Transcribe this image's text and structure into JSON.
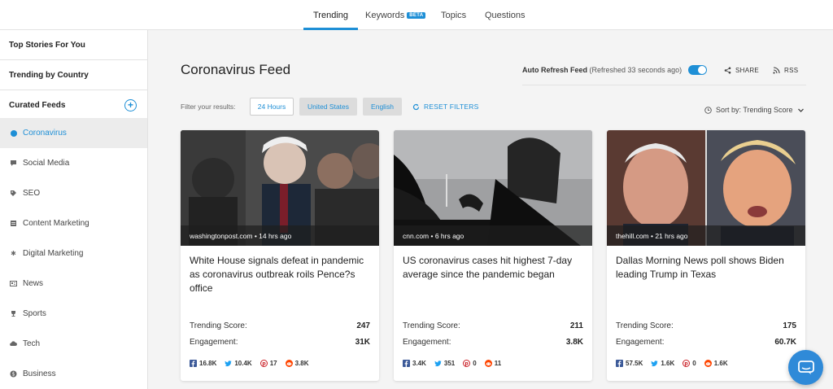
{
  "nav": {
    "tabs": [
      {
        "label": "Trending",
        "active": true
      },
      {
        "label": "Keywords",
        "badge": "BETA"
      },
      {
        "label": "Topics"
      },
      {
        "label": "Questions"
      }
    ]
  },
  "sidebar": {
    "top_stories": "Top Stories For You",
    "trending_by_country": "Trending by Country",
    "curated_feeds": "Curated Feeds",
    "feeds": [
      {
        "label": "Coronavirus",
        "icon": "dot-icon",
        "active": true
      },
      {
        "label": "Social Media",
        "icon": "chat-bubble-icon"
      },
      {
        "label": "SEO",
        "icon": "tag-icon"
      },
      {
        "label": "Content Marketing",
        "icon": "document-icon"
      },
      {
        "label": "Digital Marketing",
        "icon": "gear-icon"
      },
      {
        "label": "News",
        "icon": "newspaper-icon"
      },
      {
        "label": "Sports",
        "icon": "trophy-icon"
      },
      {
        "label": "Tech",
        "icon": "cloud-icon"
      },
      {
        "label": "Business",
        "icon": "dollar-icon"
      }
    ]
  },
  "main": {
    "title": "Coronavirus Feed",
    "auto_refresh_label": "Auto Refresh Feed",
    "auto_refresh_status": "(Refreshed 33 seconds ago)",
    "share_label": "SHARE",
    "rss_label": "RSS",
    "filter_label": "Filter your results:",
    "filters": [
      "24 Hours",
      "United States",
      "English"
    ],
    "reset_label": "RESET FILTERS",
    "sort_label": "Sort by: Trending Score"
  },
  "cards": [
    {
      "meta": "washingtonpost.com • 14 hrs ago",
      "title": "White House signals defeat in pandemic as coronavirus outbreak roils Pence?s office",
      "trending_label": "Trending Score:",
      "trending_score": "247",
      "engagement_label": "Engagement:",
      "engagement": "31K",
      "facebook": "16.8K",
      "twitter": "10.4K",
      "pinterest": "17",
      "reddit": "3.8K"
    },
    {
      "meta": "cnn.com • 6 hrs ago",
      "title": "US coronavirus cases hit highest 7-day average since the pandemic began",
      "trending_label": "Trending Score:",
      "trending_score": "211",
      "engagement_label": "Engagement:",
      "engagement": "3.8K",
      "facebook": "3.4K",
      "twitter": "351",
      "pinterest": "0",
      "reddit": "11"
    },
    {
      "meta": "thehill.com • 21 hrs ago",
      "title": "Dallas Morning News poll shows Biden leading Trump in Texas",
      "trending_label": "Trending Score:",
      "trending_score": "175",
      "engagement_label": "Engagement:",
      "engagement": "60.7K",
      "facebook": "57.5K",
      "twitter": "1.6K",
      "pinterest": "0",
      "reddit": "1.6K"
    }
  ],
  "colors": {
    "accent": "#1e8fd6",
    "facebook": "#3b5998",
    "twitter": "#1da1f2",
    "pinterest": "#cb2027",
    "reddit": "#ff4500"
  }
}
